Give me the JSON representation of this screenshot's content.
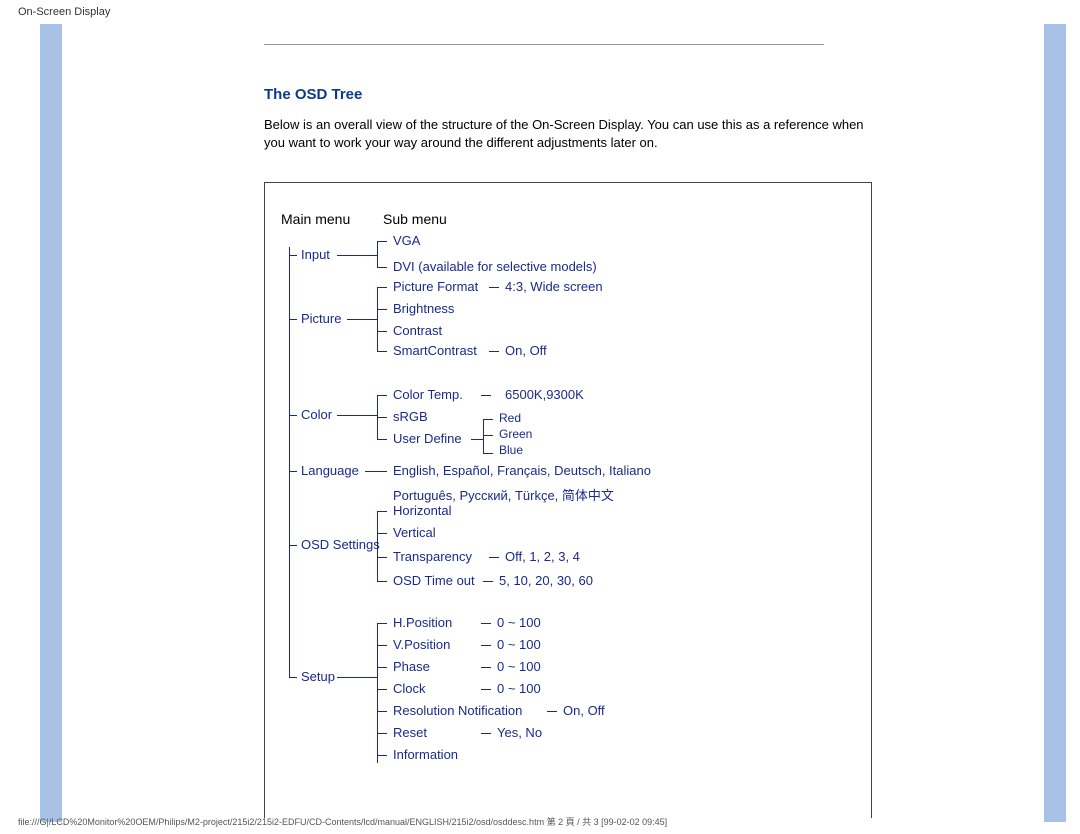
{
  "header_title": "On-Screen Display",
  "section_title": "The OSD Tree",
  "intro_text": "Below is an overall view of the structure of the On-Screen Display. You can use this as a reference when you want to work your way around the different adjustments later on.",
  "column_headers": {
    "main": "Main menu",
    "sub": "Sub menu"
  },
  "tree": {
    "input": {
      "label": "Input",
      "sub": {
        "vga": "VGA",
        "dvi": "DVI (available for selective models)"
      }
    },
    "picture": {
      "label": "Picture",
      "sub": {
        "format": "Picture Format",
        "format_opts": "4:3, Wide screen",
        "brightness": "Brightness",
        "contrast": "Contrast",
        "smart": "SmartContrast",
        "smart_opts": "On, Off"
      }
    },
    "color": {
      "label": "Color",
      "sub": {
        "temp": "Color Temp.",
        "temp_opts": "6500K,9300K",
        "srgb": "sRGB",
        "ud": "User Define",
        "ud_red": "Red",
        "ud_green": "Green",
        "ud_blue": "Blue"
      }
    },
    "language": {
      "label": "Language",
      "opts1": "English, Español, Français, Deutsch, Italiano",
      "opts2": "Português, Русский, Türkçe,  简体中文"
    },
    "osd": {
      "label": "OSD Settings",
      "sub": {
        "horiz": "Horizontal",
        "vert": "Vertical",
        "trans": "Transparency",
        "trans_opts": "Off, 1, 2, 3, 4",
        "timeout": "OSD Time out",
        "timeout_opts": "5, 10, 20, 30, 60"
      }
    },
    "setup": {
      "label": "Setup",
      "sub": {
        "hpos": "H.Position",
        "hpos_opts": "0 ~ 100",
        "vpos": "V.Position",
        "vpos_opts": "0 ~ 100",
        "phase": "Phase",
        "phase_opts": "0 ~ 100",
        "clock": "Clock",
        "clock_opts": "0 ~ 100",
        "resn": "Resolution Notification",
        "resn_opts": "On, Off",
        "reset": "Reset",
        "reset_opts": "Yes, No",
        "info": "Information"
      }
    }
  },
  "footer_text": "file:///G|/LCD%20Monitor%20OEM/Philips/M2-project/215i2/215i2-EDFU/CD-Contents/lcd/manual/ENGLISH/215i2/osd/osddesc.htm 第 2 頁 / 共 3  [99-02-02 09:45]"
}
